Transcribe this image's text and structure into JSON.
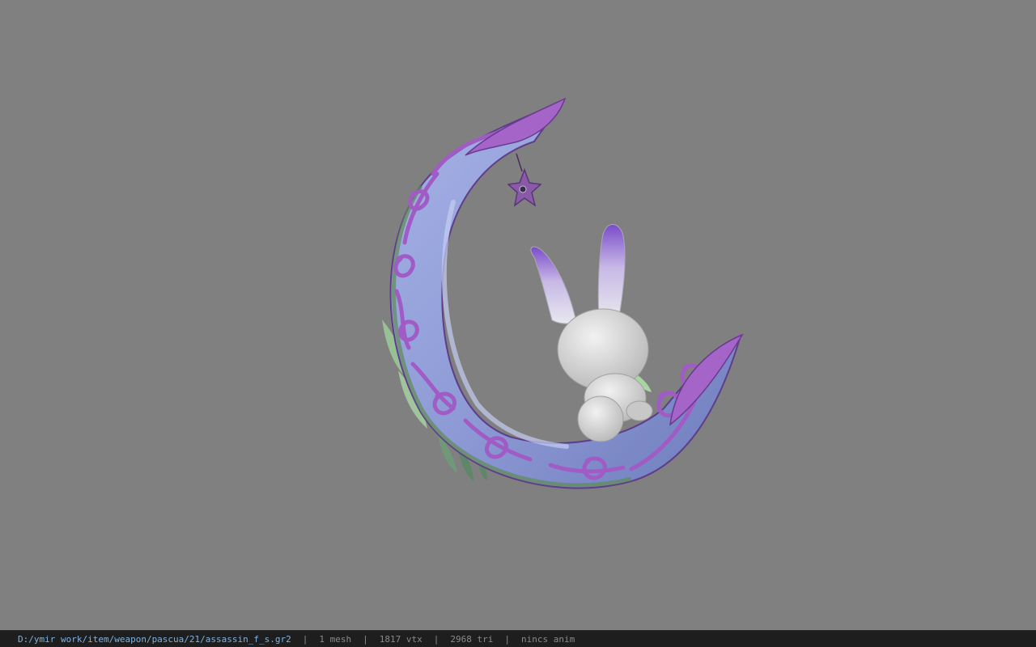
{
  "viewport": {
    "model": "crescent-moon-with-bunny"
  },
  "status_bar": {
    "file_path": "D:/ymir work/item/weapon/pascua/21/assassin_f_s.gr2",
    "separator": "|",
    "mesh_count": "1 mesh",
    "vertex_count": "1817 vtx",
    "triangle_count": "2968 tri",
    "anim_status": "nincs anim"
  },
  "colors": {
    "background": "#808080",
    "status_bar_bg": "#1e1e1e",
    "path_text": "#7fb2e0",
    "stat_text": "#8a8a8a",
    "moon_body": "#8f9ed4",
    "ornament_purple": "#a060c0",
    "bunny_body": "#d8d8d8"
  }
}
